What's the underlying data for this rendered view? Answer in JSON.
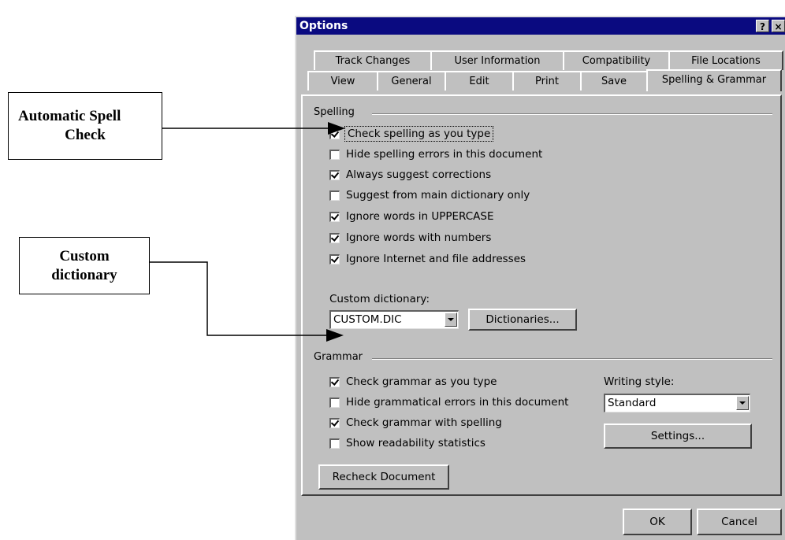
{
  "callouts": {
    "spell_check": {
      "line1": "Automatic Spell",
      "line2": "Check"
    },
    "custom_dictionary": {
      "line1": "Custom",
      "line2": "dictionary"
    }
  },
  "dialog": {
    "title": "Options",
    "help_glyph": "?",
    "close_glyph": "×",
    "tabs_back": [
      "Track Changes",
      "User Information",
      "Compatibility",
      "File Locations"
    ],
    "tabs_front": [
      "View",
      "General",
      "Edit",
      "Print",
      "Save",
      "Spelling & Grammar"
    ],
    "active_tab": "Spelling & Grammar"
  },
  "spelling": {
    "group_label": "Spelling",
    "options": [
      {
        "label": "Check spelling as you type",
        "checked": true
      },
      {
        "label": "Hide spelling errors in this document",
        "checked": false
      },
      {
        "label": "Always suggest corrections",
        "checked": true
      },
      {
        "label": "Suggest from main dictionary only",
        "checked": false
      },
      {
        "label": "Ignore words in UPPERCASE",
        "checked": true
      },
      {
        "label": "Ignore words with numbers",
        "checked": true
      },
      {
        "label": "Ignore Internet and file addresses",
        "checked": true
      }
    ],
    "custom_dictionary_label": "Custom dictionary:",
    "custom_dictionary_value": "CUSTOM.DIC",
    "dictionaries_button": "Dictionaries..."
  },
  "grammar": {
    "group_label": "Grammar",
    "options": [
      {
        "label": "Check grammar as you type",
        "checked": true
      },
      {
        "label": "Hide grammatical errors in this document",
        "checked": false
      },
      {
        "label": "Check grammar with spelling",
        "checked": true
      },
      {
        "label": "Show readability statistics",
        "checked": false
      }
    ],
    "writing_style_label": "Writing style:",
    "writing_style_value": "Standard",
    "settings_button": "Settings...",
    "recheck_button": "Recheck Document"
  },
  "footer": {
    "ok_label": "OK",
    "cancel_label": "Cancel"
  },
  "colors": {
    "title_bar": "#0a0a80",
    "dialog_face": "#c0c0c0"
  }
}
